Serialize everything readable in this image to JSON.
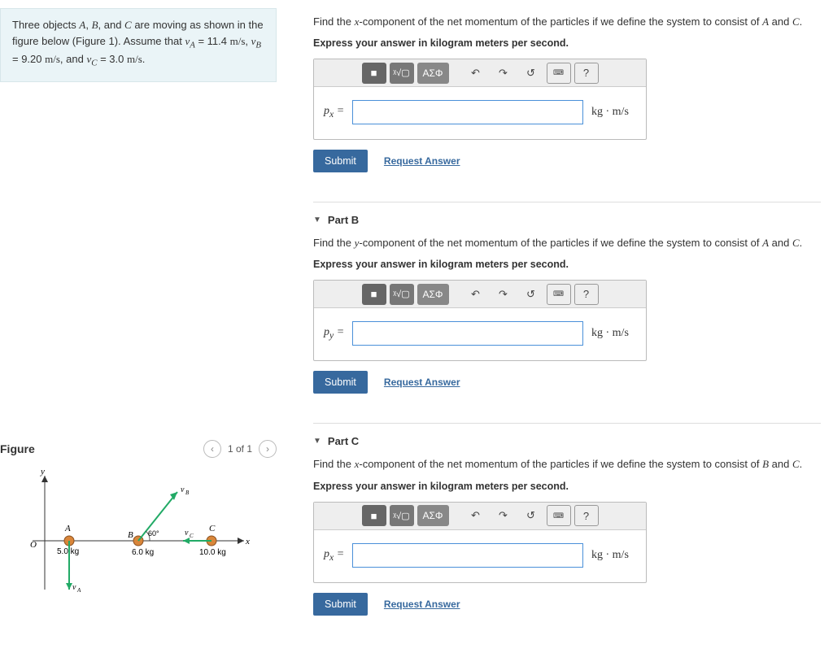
{
  "problem": {
    "text_plain": "Three objects A, B, and C are moving as shown in the figure below (Figure 1). Assume that v_A = 11.4 m/s, v_B = 9.20 m/s, and v_C = 3.0 m/s."
  },
  "figure": {
    "title": "Figure",
    "pager_label": "1 of 1",
    "objects": {
      "A": {
        "label": "A",
        "mass": "5.0 kg",
        "v_label": "v_A"
      },
      "B": {
        "label": "B",
        "mass": "6.0 kg",
        "angle": "60°",
        "v_label": "v_B"
      },
      "C": {
        "label": "C",
        "mass": "10.0 kg",
        "v_label": "v_C"
      }
    },
    "axes": {
      "x": "x",
      "y": "y",
      "origin": "O"
    }
  },
  "toolbar": {
    "template": "■",
    "radical": "ᵡ√▢",
    "greek": "ΑΣΦ",
    "undo": "↶",
    "redo": "↷",
    "reset": "↺",
    "keyboard": "⌨",
    "help": "?"
  },
  "common": {
    "submit": "Submit",
    "request": "Request Answer",
    "unit": "kg · m/s",
    "instruct": "Express your answer in kilogram meters per second."
  },
  "parts": {
    "A": {
      "title": "",
      "prompt_plain": "Find the x-component of the net momentum of the particles if we define the system to consist of A and C.",
      "var": "p_x ="
    },
    "B": {
      "title": "Part B",
      "prompt_plain": "Find the y-component of the net momentum of the particles if we define the system to consist of A and C.",
      "var": "p_y ="
    },
    "C": {
      "title": "Part C",
      "prompt_plain": "Find the x-component of the net momentum of the particles if we define the system to consist of B and C.",
      "var": "p_x ="
    }
  }
}
